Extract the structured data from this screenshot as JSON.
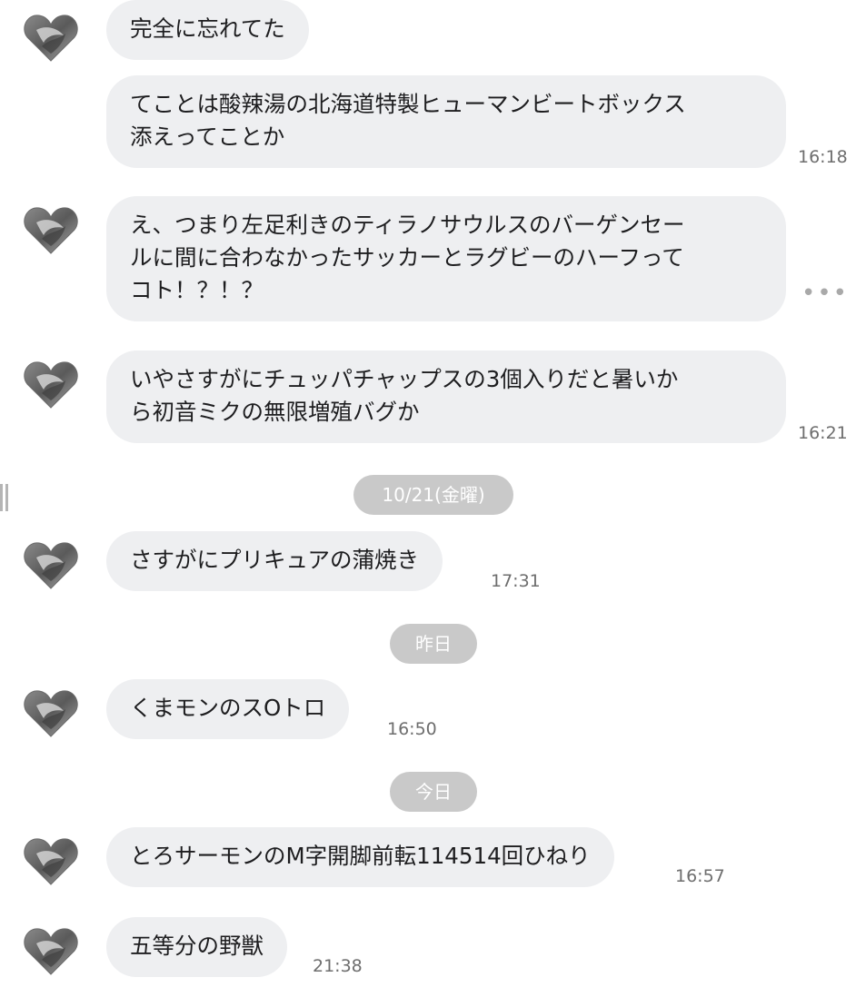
{
  "messages": [
    {
      "text": "完全に忘れてた",
      "time": ""
    },
    {
      "text": "てことは酸辣湯の北海道特製ヒューマンビートボックス\n添えってことか",
      "time": "16:18"
    },
    {
      "text": "え、つまり左足利きのティラノサウルスのバーゲンセー\nルに間に合わなかったサッカーとラグビーのハーフって\nコト！？！？",
      "time": ""
    },
    {
      "text": "いやさすがにチュッパチャップスの3個入りだと暑いか\nら初音ミクの無限増殖バグか",
      "time": "16:21"
    },
    {
      "text": "さすがにプリキュアの蒲焼き",
      "time": "17:31"
    },
    {
      "text": "くまモンのスOトロ",
      "time": "16:50"
    },
    {
      "text": "とろサーモンのM字開脚前転114514回ひねり",
      "time": "16:57"
    },
    {
      "text": "五等分の野獣",
      "time": "21:38"
    }
  ],
  "date_separators": [
    "10/21(金曜)",
    "昨日",
    "今日"
  ],
  "more_icon": "ellipsis-icon",
  "avatar_icon": "heart-avatar-icon",
  "colors": {
    "bubble": "#eeeff1",
    "separator": "#c9c9c9",
    "time": "#6e6e6e"
  }
}
